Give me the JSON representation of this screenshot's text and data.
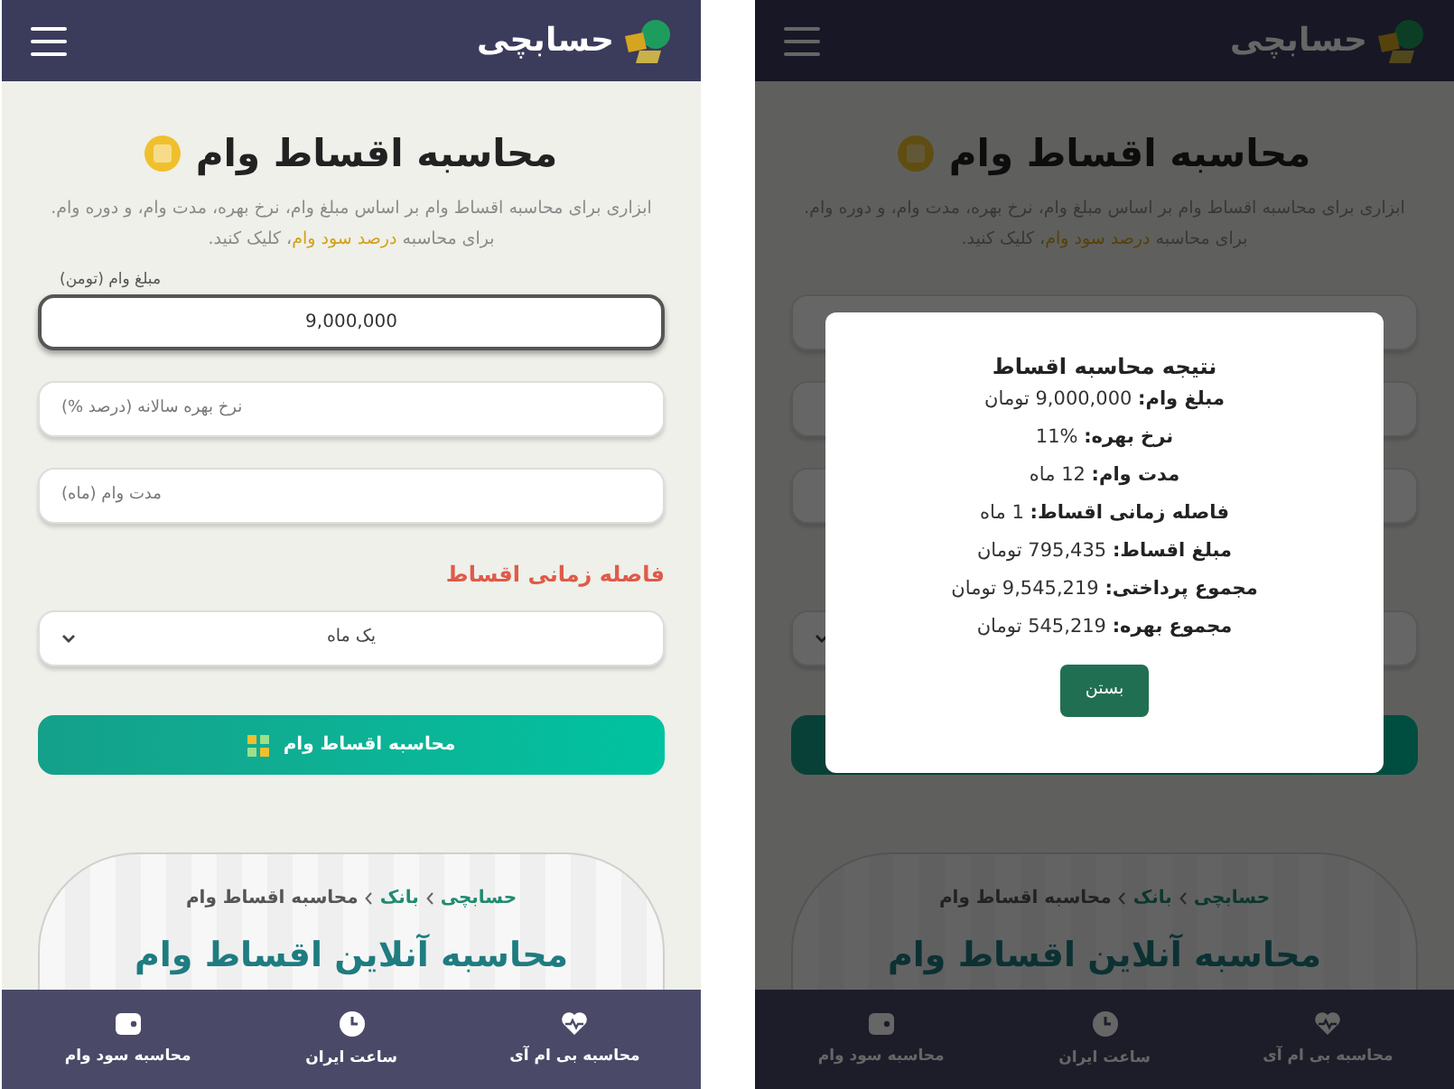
{
  "screens": [
    {
      "header": {
        "logo_text": "حسابچی"
      },
      "title": "محاسبه اقساط وام",
      "description": {
        "before": "ابزاری برای محاسبه اقساط وام بر اساس مبلغ وام، نرخ بهره، مدت وام، و دوره وام. برای محاسبه",
        "link": "درصد سود وام",
        "after": "، کلیک کنید."
      },
      "fields": [
        {
          "focused": false
        },
        {
          "focused": false
        },
        {
          "focused": false
        }
      ],
      "breadcrumb": [
        {
          "label": "حسابچی",
          "link": true
        },
        {
          "label": "بانک",
          "link": true
        },
        {
          "label": "محاسبه اقساط وام",
          "link": false
        }
      ],
      "article": {
        "heading": "محاسبه آنلاین اقساط وام"
      },
      "bottom_nav": [
        {
          "label": "محاسبه بی ام آی",
          "kind": "heart"
        },
        {
          "label": "ساعت ایران",
          "kind": "clock"
        },
        {
          "label": "محاسبه سود وام",
          "kind": "wallet"
        }
      ],
      "modal": {
        "title": "نتیجه محاسبه اقساط",
        "rows": [
          {
            "label": "مبلغ وام:",
            "value": "9,000,000 تومان"
          },
          {
            "label": "نرخ بهره:",
            "value": "11%"
          },
          {
            "label": "مدت وام:",
            "value": "12 ماه"
          },
          {
            "label": "فاصله زمانی اقساط:",
            "value": "1 ماه"
          },
          {
            "label": "مبلغ اقساط:",
            "value": "795,435 تومان"
          },
          {
            "label": "مجموع پرداختی:",
            "value": "9,545,219 تومان"
          },
          {
            "label": "مجموع بهره:",
            "value": "545,219 تومان"
          }
        ],
        "close_button": "بستن"
      }
    },
    {
      "header": {
        "logo_text": "حسابچی"
      },
      "title": "محاسبه اقساط وام",
      "description": {
        "before": "ابزاری برای محاسبه اقساط وام بر اساس مبلغ وام، نرخ بهره، مدت وام، و دوره وام. برای محاسبه",
        "link": "درصد سود وام",
        "after": "، کلیک کنید."
      },
      "fields": [
        {
          "label": "مبلغ وام (تومن)",
          "value": "9,000,000",
          "focused": true
        },
        {
          "placeholder": "نرخ بهره سالانه (درصد %)",
          "focused": false
        },
        {
          "placeholder": "مدت وام (ماه)",
          "focused": false
        }
      ],
      "interval_label": "فاصله زمانی اقساط",
      "interval_select": {
        "value": "یک ماه"
      },
      "calculate_button": {
        "label": "محاسبه اقساط وام"
      },
      "breadcrumb": [
        {
          "label": "حسابچی",
          "link": true
        },
        {
          "label": "بانک",
          "link": true
        },
        {
          "label": "محاسبه اقساط وام",
          "link": false
        }
      ],
      "article": {
        "heading": "محاسبه آنلاین اقساط وام"
      },
      "bottom_nav": [
        {
          "label": "محاسبه بی ام آی",
          "kind": "heart"
        },
        {
          "label": "ساعت ایران",
          "kind": "clock"
        },
        {
          "label": "محاسبه سود وام",
          "kind": "wallet"
        }
      ]
    }
  ]
}
